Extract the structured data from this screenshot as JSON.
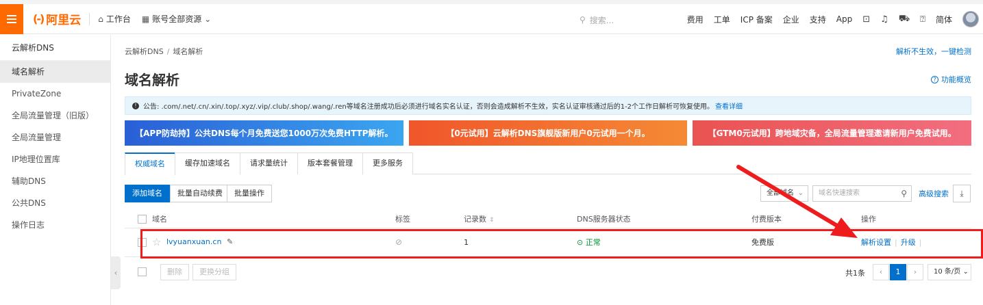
{
  "topbar": {
    "logo_mark": "(-)",
    "logo_text": "阿里云",
    "workbench": "工作台",
    "resource_scope": "账号全部资源",
    "search_placeholder": "搜索...",
    "links": [
      "费用",
      "工单",
      "ICP 备案",
      "企业",
      "支持",
      "App"
    ],
    "lang": "简体"
  },
  "sidebar": {
    "title": "云解析DNS",
    "items": [
      {
        "label": "域名解析",
        "active": true
      },
      {
        "label": "PrivateZone"
      },
      {
        "label": "全局流量管理（旧版）"
      },
      {
        "label": "全局流量管理"
      },
      {
        "label": "IP地理位置库"
      },
      {
        "label": "辅助DNS"
      },
      {
        "label": "公共DNS"
      },
      {
        "label": "操作日志"
      }
    ]
  },
  "breadcrumb": [
    "云解析DNS",
    "域名解析"
  ],
  "detect_link": "解析不生效，一键检测",
  "page_title": "域名解析",
  "overview_link": "功能概览",
  "notice": {
    "text": "公告: .com/.net/.cn/.xin/.top/.xyz/.vip/.club/.shop/.wang/.ren等域名注册成功后必须进行域名实名认证，否则会造成解析不生效，实名认证审核通过后的1-2个工作日解析可恢复使用。",
    "link": "查看详细"
  },
  "banners": [
    "【APP防劫持】公共DNS每个月免费送您1000万次免费HTTP解析。",
    "【0元试用】云解析DNS旗舰版新用户0元试用一个月。",
    "【GTM0元试用】跨地域灾备，全局流量管理邀请新用户免费试用。"
  ],
  "tabs": [
    "权威域名",
    "缓存加速域名",
    "请求量统计",
    "版本套餐管理",
    "更多服务"
  ],
  "toolbar": {
    "add_domain": "添加域名",
    "batch_renew": "批量自动续费",
    "batch_ops": "批量操作",
    "filter": "全部域名",
    "search_placeholder": "域名快速搜索",
    "advanced": "高级搜索"
  },
  "table": {
    "headers": {
      "domain": "域名",
      "tag": "标签",
      "records": "记录数",
      "dns_status": "DNS服务器状态",
      "edition": "付费版本",
      "ops": "操作"
    },
    "rows": [
      {
        "domain": "lvyuanxuan.cn",
        "records": "1",
        "dns_status": "正常",
        "edition": "免费版",
        "op_settings": "解析设置",
        "op_upgrade": "升级"
      }
    ]
  },
  "footer": {
    "delete": "删除",
    "change_group": "更换分组",
    "total": "共1条",
    "current_page": "1",
    "page_size": "10 条/页"
  },
  "colors": {
    "brand": "#ff6a00",
    "link": "#0070cc",
    "ok": "#009431",
    "annotation": "#ee1c1c"
  }
}
